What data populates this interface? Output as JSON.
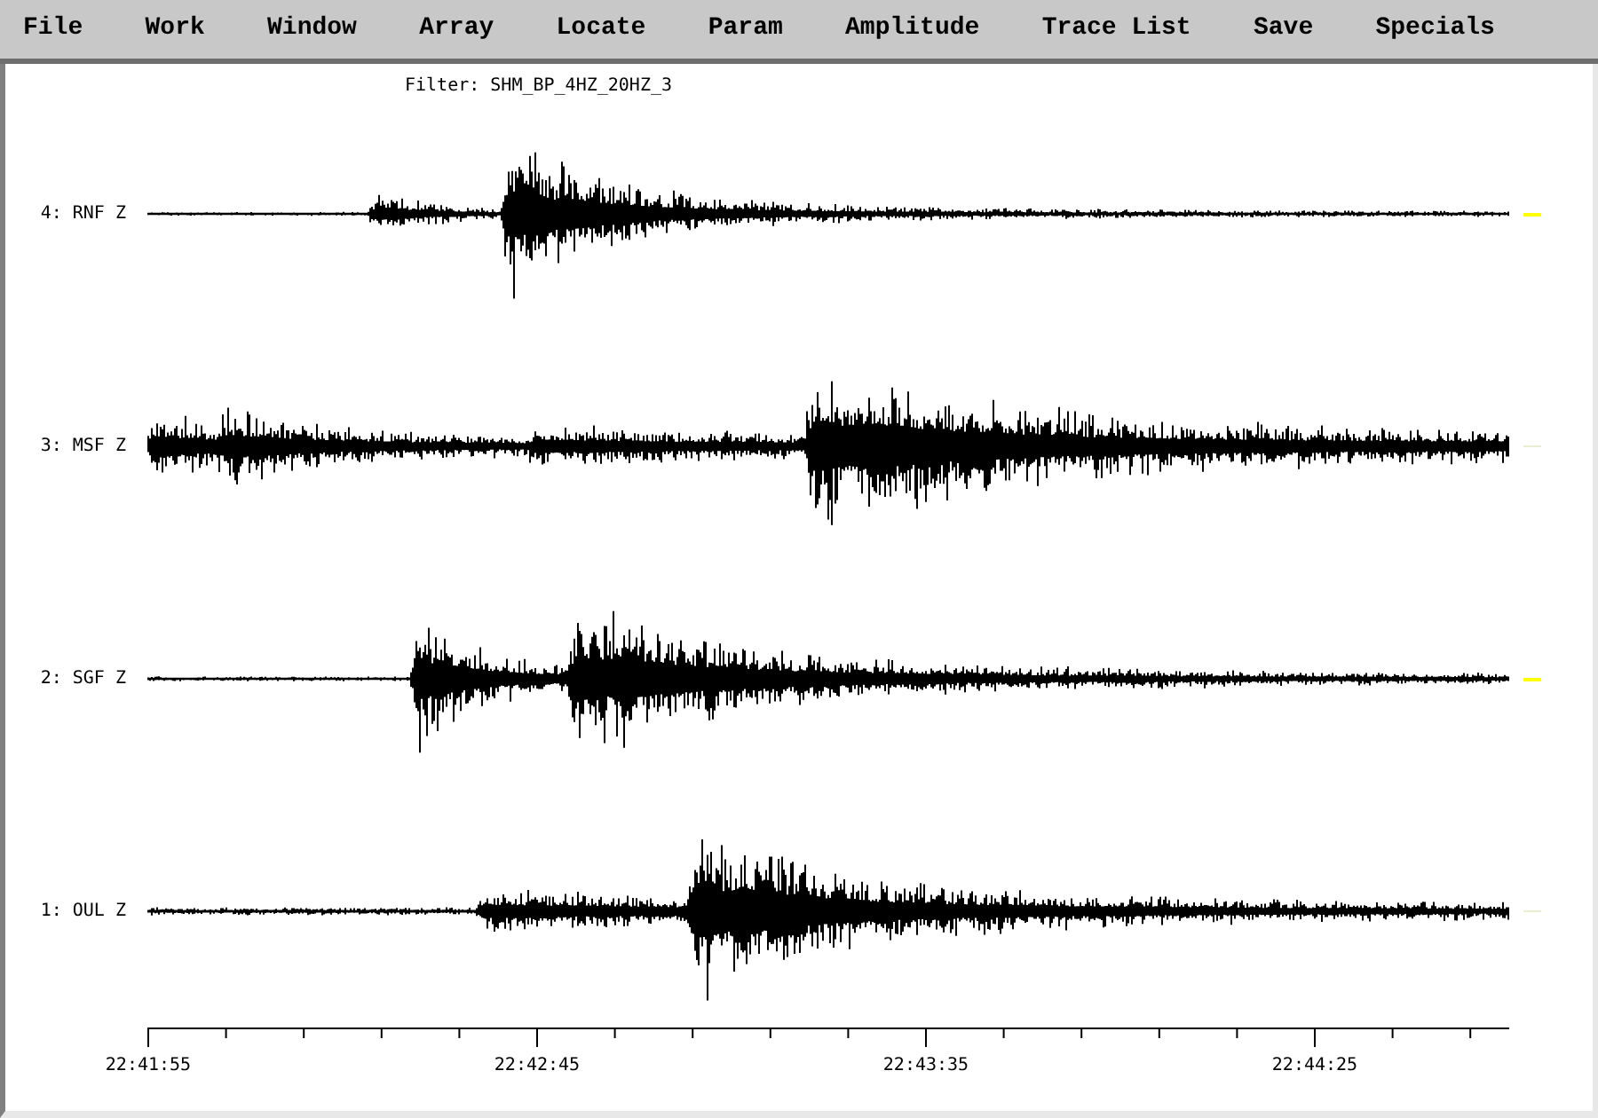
{
  "menu": [
    "File",
    "Work",
    "Window",
    "Array",
    "Locate",
    "Param",
    "Amplitude",
    "Trace List",
    "Save",
    "Specials"
  ],
  "filter": "Filter: SHM_BP_4HZ_20HZ_3",
  "traces": [
    {
      "label": "4: RNF Z",
      "selected": true
    },
    {
      "label": "3: MSF Z",
      "selected": false
    },
    {
      "label": "2: SGF Z",
      "selected": true
    },
    {
      "label": "1: OUL Z",
      "selected": false
    }
  ],
  "time_axis": {
    "labels": [
      "22:41:55",
      "22:42:45",
      "22:43:35",
      "22:44:25"
    ]
  }
}
